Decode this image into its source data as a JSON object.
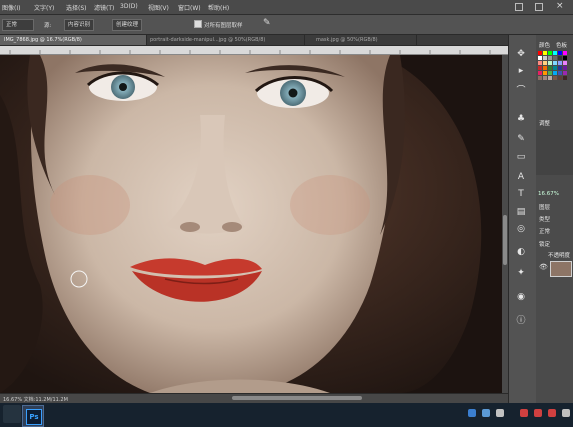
{
  "menu": {
    "items": [
      "图像(I)",
      "文字(Y)",
      "选择(S)",
      "滤镜(T)",
      "3D(D)",
      "视图(V)",
      "窗口(W)",
      "帮助(H)"
    ]
  },
  "options": {
    "mode_label": "正常",
    "source_label": "源:",
    "source_btn": "内容识别",
    "sample_btn": "创建纹理",
    "sample_all": "对所有图层取样"
  },
  "tabs": [
    {
      "label": "IMG_7868.jpg @ 16.7%(RGB/8)",
      "active": true
    },
    {
      "label": "portrait-darkside-manipul...jpg @ 50%(RGB/8)",
      "active": false
    },
    {
      "label": "mask.jpg @ 50%(RGB/8)",
      "active": false
    }
  ],
  "status": {
    "text": "16.67%   文档:11.2M/11.2M"
  },
  "panels": {
    "color_tab": "颜色",
    "swatches_tab": "色板",
    "adjust_tab": "调整",
    "layers_tab": "图层",
    "kind_label": "类型",
    "blend_label": "正常",
    "lock_label": "锁定",
    "opacity_value": "不透明度",
    "zoom_value": "16.67%"
  },
  "colors": {
    "accent": "#39a0ff",
    "taskbar": "#16222e",
    "lips": "#c63a2d",
    "iris": "#8ab4c0",
    "hair": "#2a1c16",
    "skin": "#d2c0b0"
  },
  "icons": {
    "tools": [
      "move-icon",
      "marquee-icon",
      "lasso-icon",
      "brush-icon",
      "stamp-icon",
      "eraser-icon",
      "pen-icon",
      "text-icon",
      "hand-icon",
      "zoom-icon"
    ],
    "tray": [
      "network-icon",
      "volume-icon",
      "chat-icon",
      "security-icon"
    ]
  }
}
